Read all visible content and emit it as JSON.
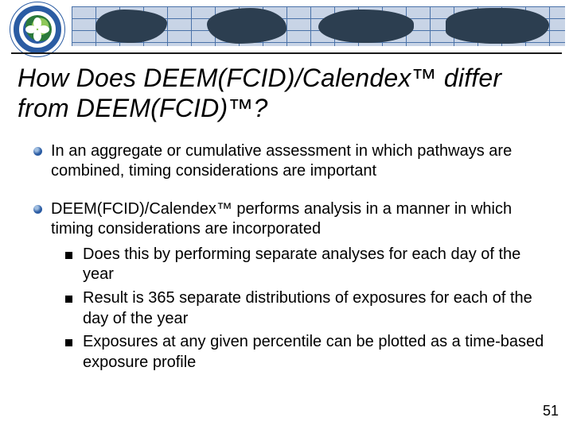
{
  "logo": {
    "name": "epa-seal"
  },
  "title": "How Does DEEM(FCID)/Calendex™ differ from DEEM(FCID)™?",
  "bullets": [
    {
      "text": "In an aggregate or cumulative assessment in which pathways are combined, timing considerations are important"
    },
    {
      "text": "DEEM(FCID)/Calendex™ performs analysis in a manner in which timing considerations are incorporated",
      "sub": [
        "Does this by performing separate analyses for each day of the year",
        "Result is 365 separate distributions of exposures for each of the day of the  year",
        "Exposures at any given percentile can be plotted as a time-based exposure profile"
      ]
    }
  ],
  "page_number": "51"
}
